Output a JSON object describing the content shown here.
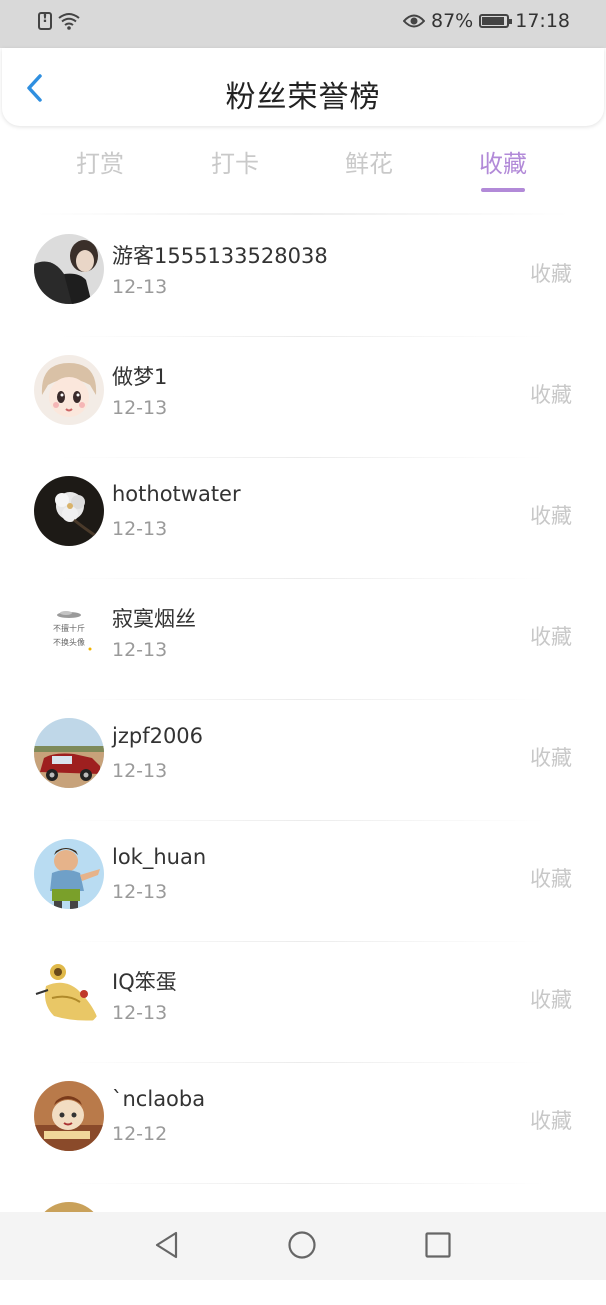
{
  "status_bar": {
    "battery_percent": "87%",
    "time": "17:18",
    "icons": [
      "sim-alert-icon",
      "wifi-icon",
      "eye-icon",
      "battery-icon"
    ]
  },
  "header": {
    "title": "粉丝荣誉榜",
    "back_icon": "chevron-left-icon"
  },
  "tabs": [
    {
      "label": "打赏",
      "active": false
    },
    {
      "label": "打卡",
      "active": false
    },
    {
      "label": "鲜花",
      "active": false
    },
    {
      "label": "收藏",
      "active": true
    }
  ],
  "fans": [
    {
      "name": "游客1555133528038",
      "date": "12-13",
      "action": "收藏"
    },
    {
      "name": "做梦1",
      "date": "12-13",
      "action": "收藏"
    },
    {
      "name": "hothotwater",
      "date": "12-13",
      "action": "收藏"
    },
    {
      "name": "寂寞烟丝",
      "date": "12-13",
      "action": "收藏",
      "avatar_text": [
        "不擅十斤",
        "不换头像"
      ]
    },
    {
      "name": "jzpf2006",
      "date": "12-13",
      "action": "收藏"
    },
    {
      "name": "lok_huan",
      "date": "12-13",
      "action": "收藏"
    },
    {
      "name": "IQ笨蛋",
      "date": "12-13",
      "action": "收藏"
    },
    {
      "name": "`nclaoba",
      "date": "12-12",
      "action": "收藏"
    }
  ],
  "colors": {
    "accent": "#b28ad8",
    "back_icon": "#2f8fe0",
    "status_bar_bg": "#d9d9d9"
  }
}
